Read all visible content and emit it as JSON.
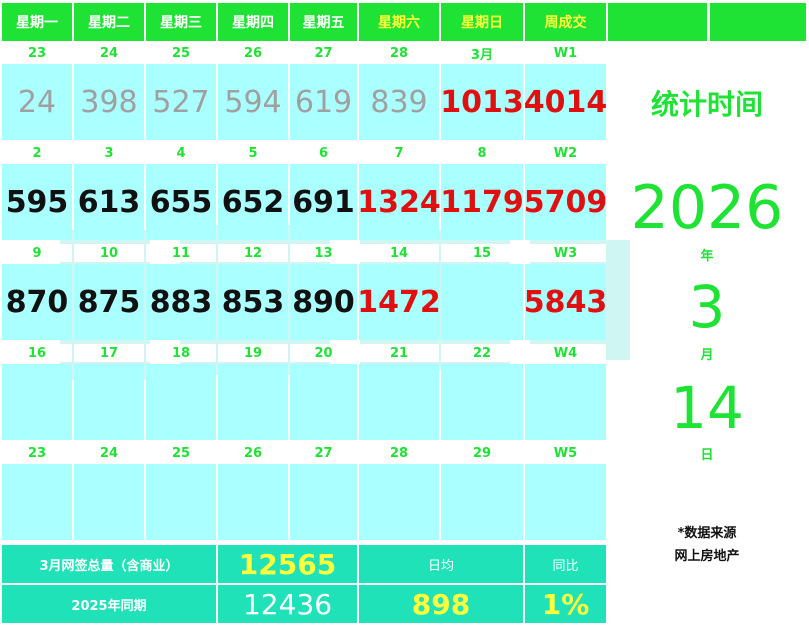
{
  "headers": [
    "星期一",
    "星期二",
    "星期三",
    "星期四",
    "星期五",
    "星期六",
    "星期日",
    "周成交"
  ],
  "weeks": [
    {
      "dates": [
        "23",
        "24",
        "25",
        "26",
        "27",
        "28",
        "3月",
        "W1"
      ],
      "values": [
        "24",
        "398",
        "527",
        "594",
        "619",
        "839",
        "1013",
        "4014"
      ]
    },
    {
      "dates": [
        "2",
        "3",
        "4",
        "5",
        "6",
        "7",
        "8",
        "W2"
      ],
      "values": [
        "595",
        "613",
        "655",
        "652",
        "691",
        "1324",
        "1179",
        "5709"
      ]
    },
    {
      "dates": [
        "9",
        "10",
        "11",
        "12",
        "13",
        "14",
        "15",
        "W3"
      ],
      "values": [
        "870",
        "875",
        "883",
        "853",
        "890",
        "1472",
        "",
        "5843"
      ]
    },
    {
      "dates": [
        "16",
        "17",
        "18",
        "19",
        "20",
        "21",
        "22",
        "W4"
      ],
      "values": [
        "",
        "",
        "",
        "",
        "",
        "",
        "",
        ""
      ]
    },
    {
      "dates": [
        "23",
        "24",
        "25",
        "26",
        "27",
        "28",
        "29",
        "W5"
      ],
      "values": [
        "",
        "",
        "",
        "",
        "",
        "",
        "",
        ""
      ]
    }
  ],
  "side": {
    "title": "统计时间",
    "year": "2026",
    "year_unit": "年",
    "month": "3",
    "month_unit": "月",
    "day": "14",
    "day_unit": "日",
    "source_label": "*数据来源",
    "source_name": "网上房地产"
  },
  "footer": {
    "row1_label": "3月网签总量（含商业）",
    "row1_value": "12565",
    "row1_avg_label": "日均",
    "row1_yoy_label": "同比",
    "row2_label": "2025年同期",
    "row2_value": "12436",
    "row2_avg_value": "898",
    "row2_yoy_value": "1%"
  },
  "colors": {
    "accent_green": "#1ee335",
    "cell_cyan": "#aaffff",
    "footer_teal": "#1fe2b8",
    "red": "#e01010",
    "yellow": "#ffff3a"
  }
}
